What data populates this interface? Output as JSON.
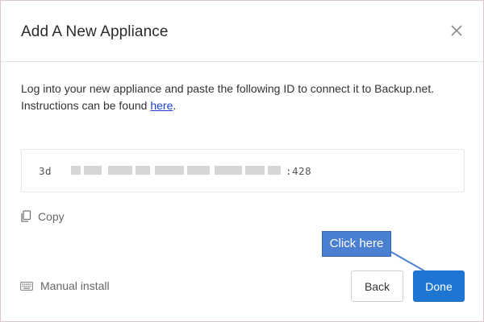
{
  "dialog": {
    "title": "Add A New Appliance",
    "close_icon": "close-icon"
  },
  "instructions": {
    "line1": "Log into your new appliance and paste the following ID to connect it to Backup.net.",
    "line2_prefix": "Instructions can be found ",
    "link_text": "here",
    "line2_suffix": "."
  },
  "appliance_id": {
    "prefix": "3d",
    "suffix": ":428",
    "redacted": true
  },
  "copy": {
    "label": "Copy",
    "icon": "copy-icon"
  },
  "manual_install": {
    "label": "Manual install",
    "icon": "keyboard-icon"
  },
  "buttons": {
    "back_label": "Back",
    "done_label": "Done"
  },
  "annotation": {
    "label": "Click here"
  },
  "colors": {
    "primary": "#1f76d2",
    "callout": "#4a7fd1",
    "link": "#1a3fd6"
  }
}
